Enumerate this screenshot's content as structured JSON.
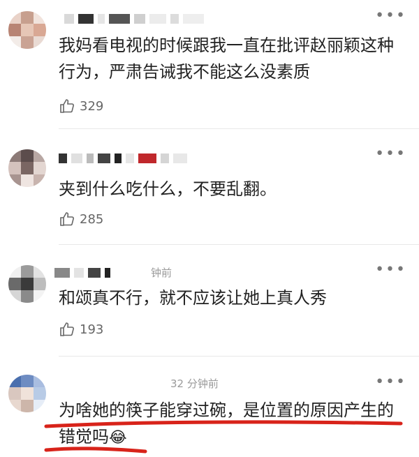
{
  "comments": [
    {
      "text": "我妈看电视的时候跟我一直在批评赵丽颖这种行为，严肃告诫我不能这么没素质",
      "likes": "329",
      "time": ""
    },
    {
      "text": "夹到什么吃什么，不要乱翻。",
      "likes": "285",
      "time": ""
    },
    {
      "text": "和颂真不行，就不应该让她上真人秀",
      "likes": "193",
      "time": "钟前"
    },
    {
      "text": "为啥她的筷子能穿过碗，是位置的原因产生的错觉吗",
      "emoji": "😂",
      "likes": "",
      "time": "32 分钟前"
    }
  ],
  "icons": {
    "more": "more-dots-icon",
    "like": "thumbs-up-icon"
  },
  "colors": {
    "underline": "#d8231a",
    "meta": "#9a9a9a"
  }
}
